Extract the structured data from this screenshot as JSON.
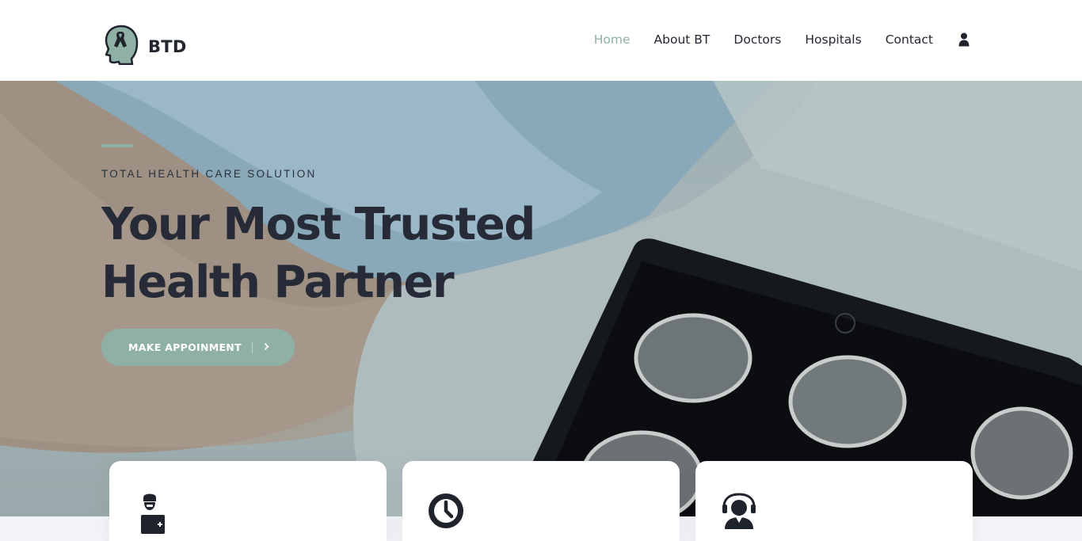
{
  "brand": {
    "name": "BTD",
    "logo_icon": "head-ribbon-icon"
  },
  "nav": {
    "items": [
      {
        "label": "Home",
        "active": true
      },
      {
        "label": "About BT",
        "active": false
      },
      {
        "label": "Doctors",
        "active": false
      },
      {
        "label": "Hospitals",
        "active": false
      },
      {
        "label": "Contact",
        "active": false
      }
    ],
    "user_icon": "user-icon"
  },
  "hero": {
    "eyebrow": "TOTAL HEALTH CARE SOLUTION",
    "headline_line1": "Your Most Trusted",
    "headline_line2": "Health Partner",
    "cta_label": "MAKE APPOINMENT",
    "cta_icon": "chevron-right-icon"
  },
  "feature_cards": [
    {
      "icon": "doctor-icon"
    },
    {
      "icon": "clock-icon"
    },
    {
      "icon": "support-agent-icon"
    }
  ],
  "colors": {
    "accent": "#8fb0a5",
    "text_dark": "#262b37",
    "header_bg": "#ffffff"
  }
}
